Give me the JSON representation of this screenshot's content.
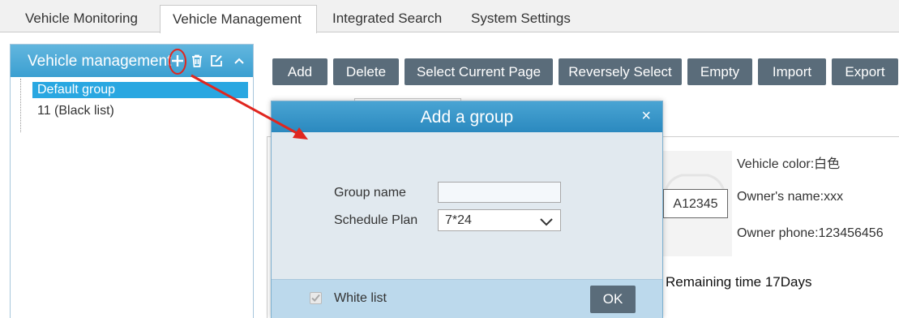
{
  "tabs": [
    {
      "label": "Vehicle Monitoring",
      "active": false
    },
    {
      "label": "Vehicle Management",
      "active": true
    },
    {
      "label": "Integrated Search",
      "active": false
    },
    {
      "label": "System Settings",
      "active": false
    }
  ],
  "sidebar": {
    "title": "Vehicle management",
    "icons": [
      "add-icon",
      "delete-icon",
      "edit-icon",
      "collapse-icon"
    ],
    "groups": [
      {
        "label": "Default group",
        "selected": true
      },
      {
        "label": "11 (Black list)",
        "selected": false
      }
    ]
  },
  "toolbar": {
    "buttons": [
      "Add",
      "Delete",
      "Select Current Page",
      "Reversely Select",
      "Empty",
      "Import",
      "Export"
    ]
  },
  "vehicle_card": {
    "plate": "A12345",
    "color": "Vehicle color:白色",
    "owner_name": "Owner's name:xxx",
    "owner_phone": "Owner phone:123456456",
    "remaining": "Remaining time 17Days"
  },
  "dialog": {
    "title": "Add a group",
    "close": "×",
    "group_name_label": "Group name",
    "group_name_value": "",
    "schedule_label": "Schedule Plan",
    "schedule_value": "7*24",
    "white_list_label": "White list",
    "white_list_checked": true,
    "ok_label": "OK"
  },
  "colors": {
    "accent": "#3b9fd1",
    "button": "#5a6c7a",
    "annotation": "#e0261f"
  }
}
